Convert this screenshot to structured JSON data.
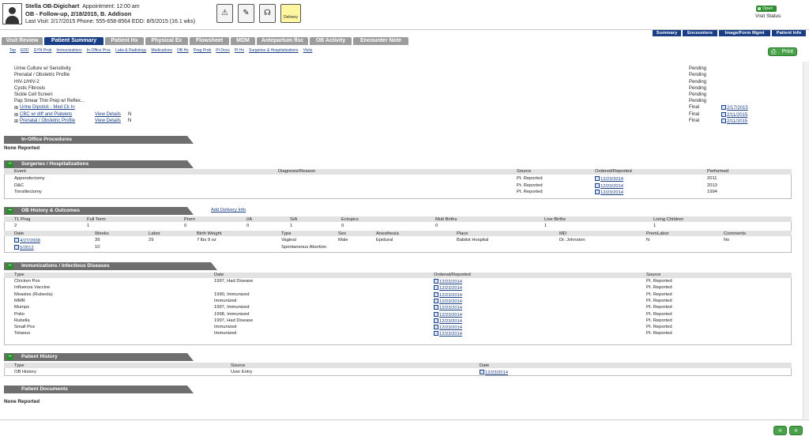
{
  "header": {
    "name": "Stella OB-Digichart",
    "appt": "Appointment: 12:00 am",
    "line2": "OB - Follow-up, 2/18/2015, B. Addison",
    "line3": "Last Visit: 2/17/2015  Phone: 555-658-8564  EDD: 8/5/2015 (16.1 wks)",
    "delivery": "Delivery",
    "open": "Open",
    "visit_status": "Visit Status"
  },
  "right_tabs": [
    "Summary",
    "Encounters",
    "Image/Form Mgmt",
    "Patient Info"
  ],
  "tabs": [
    "Visit Review",
    "Patient Summary",
    "Patient Hx",
    "Physical Ex",
    "Flowsheet",
    "MDM",
    "Antepartum flsc",
    "OB Activity",
    "Encounter Note"
  ],
  "subnav": [
    "Top",
    "EDD",
    "GYN Prob",
    "Immunizations",
    "In-Office Proc",
    "Labs & Radiology",
    "Medications",
    "OB Hx",
    "Preg Prob",
    "Pt Docs",
    "Pt Hx",
    "Surgeries & Hospitalizations",
    "Visits"
  ],
  "print": "Print",
  "labs": [
    {
      "name": "Urine Culture w/ Sensitivity",
      "status": "Pending"
    },
    {
      "name": "Prenatal / Obstetric Profile",
      "status": "Pending"
    },
    {
      "name": "HIV-1/HIV-2",
      "status": "Pending"
    },
    {
      "name": "Cystic Fibrosis",
      "status": "Pending"
    },
    {
      "name": "Sickle Cell Screen",
      "status": "Pending"
    },
    {
      "name": "Pap Smear Thin Prep w/ Reflex...",
      "status": "Pending"
    },
    {
      "name": "Urine Dipstick - Med Ck In",
      "status": "Final",
      "date": "2/17/2015"
    },
    {
      "name": "CBC w/ diff and Platelets",
      "view": "View Details",
      "n": "N",
      "status": "Final",
      "date": "2/11/2015"
    },
    {
      "name": "Prenatal / Obstetric Profile",
      "view": "View Details",
      "n": "N",
      "status": "Final",
      "date": "2/11/2015"
    }
  ],
  "inoffice": {
    "title": "In-Office Procedures",
    "none": "None Reported"
  },
  "surgeries": {
    "title": "Surgeries / Hospitalizations",
    "headers": [
      "Event",
      "Diagnosis/Reason",
      "Source",
      "Ordered/Reported",
      "Performed"
    ],
    "rows": [
      [
        "Appendectomy",
        "",
        "Pt. Reported",
        "12/23/2014",
        "2011"
      ],
      [
        "D&C",
        "",
        "Pt. Reported",
        "12/23/2014",
        "2013"
      ],
      [
        "Tonsillectomy",
        "",
        "Pt. Reported",
        "12/23/2014",
        "1994"
      ]
    ]
  },
  "obhx": {
    "title": "OB History & Outcomes",
    "add": "Add Delivery Info",
    "h1": [
      "TL Preg",
      "Full Term",
      "Prem",
      "I/A",
      "S/A",
      "Ectopics",
      "Mult Births",
      "Live Births",
      "Living Children"
    ],
    "v1": [
      "2",
      "1",
      "0",
      "0",
      "1",
      "0",
      "0",
      "1",
      "1"
    ],
    "h2": [
      "Date",
      "Weeks",
      "Labor",
      "Birth Weight",
      "Type",
      "Sex",
      "Anesthesia",
      "Place",
      "MD",
      "PremLabor",
      "Comments"
    ],
    "r1": [
      "4/27/2008",
      "39",
      "29",
      "7 lbs 9 oz",
      "Vaginal",
      "Male",
      "Epidural",
      "Babtist Hospital",
      "Dr. Johnston",
      "N",
      "No"
    ],
    "r2": [
      "5/2012",
      "10",
      "",
      "",
      "Spontaneous Abortion",
      "",
      "",
      "",
      "",
      "",
      ""
    ]
  },
  "immun": {
    "title": "Immunizations / Infectious Diseases",
    "headers": [
      "Type",
      "Date",
      "Ordered/Reported",
      "Source"
    ],
    "rows": [
      [
        "Chicken Pox",
        "1997, Had Disease",
        "12/23/2014",
        "Pt. Reported"
      ],
      [
        "Influenza Vaccine",
        "",
        "12/23/2014",
        "Pt. Reported"
      ],
      [
        "Measles (Rubeola)",
        "1990, Immunized",
        "12/23/2014",
        "Pt. Reported"
      ],
      [
        "MMR",
        "Immunized",
        "12/23/2014",
        "Pt. Reported"
      ],
      [
        "Mumps",
        "1997, Immunized",
        "12/23/2014",
        "Pt. Reported"
      ],
      [
        "Polio",
        "1998, Immunized",
        "12/23/2014",
        "Pt. Reported"
      ],
      [
        "Rubella",
        "1997, Had Disease",
        "12/23/2014",
        "Pt. Reported"
      ],
      [
        "Small Pox",
        "Immunized",
        "12/23/2014",
        "Pt. Reported"
      ],
      [
        "Tetanus",
        "Immunized",
        "12/23/2014",
        "Pt. Reported"
      ]
    ]
  },
  "pthx": {
    "title": "Patient History",
    "headers": [
      "Type",
      "Source",
      "Date"
    ],
    "row": [
      "OB History",
      "User Entry",
      "12/23/2014"
    ]
  },
  "ptdocs": {
    "title": "Patient Documents",
    "none": "None Reported"
  }
}
